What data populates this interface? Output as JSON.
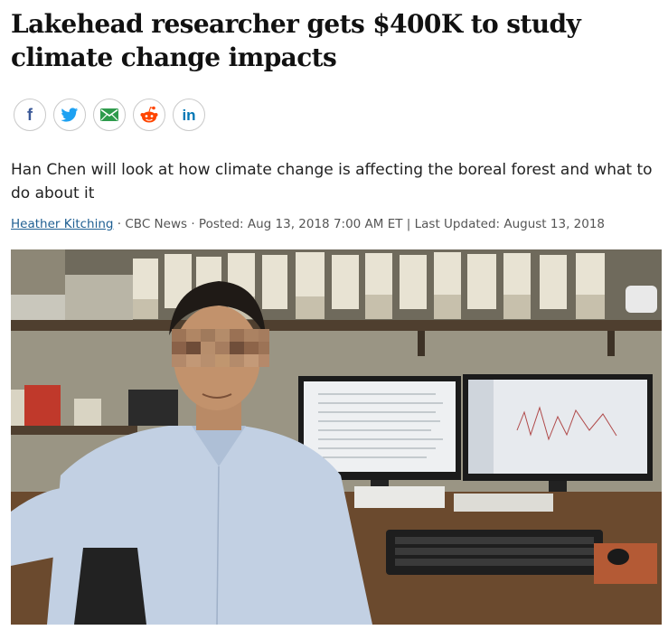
{
  "article": {
    "headline": "Lakehead researcher gets $400K to study climate change impacts",
    "dek": "Han Chen will look at how climate change is affecting the boreal forest and what to do about it",
    "byline": {
      "author": "Heather Kitching",
      "source": "CBC News",
      "posted": "Posted: Aug 13, 2018 7:00 AM ET",
      "updated": "Last Updated: August 13, 2018"
    }
  },
  "share": {
    "buttons": [
      {
        "icon": "facebook-icon",
        "color": "#3b5998"
      },
      {
        "icon": "twitter-icon",
        "color": "#1da1f2"
      },
      {
        "icon": "email-icon",
        "color": "#2e9b4c"
      },
      {
        "icon": "reddit-icon",
        "color": "#ff4500"
      },
      {
        "icon": "linkedin-icon",
        "color": "#0077b5"
      }
    ]
  },
  "colors": {
    "author_link": "#1f5f92",
    "meta_text": "#555555"
  }
}
